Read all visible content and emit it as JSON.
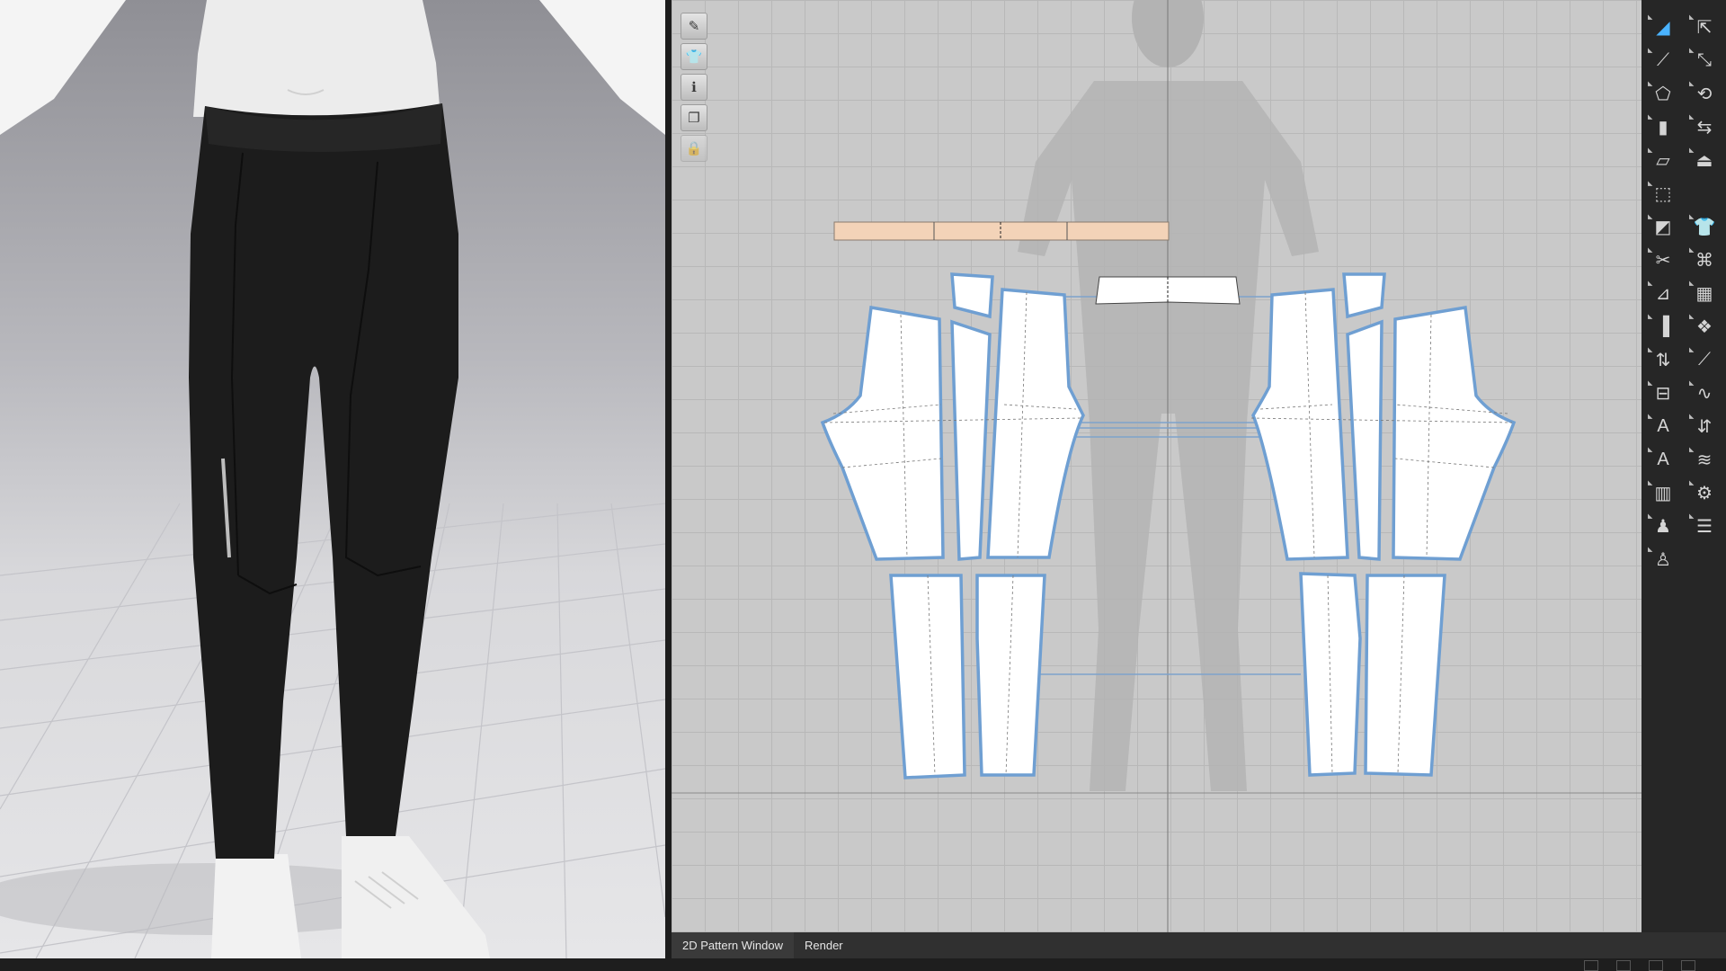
{
  "viewport_3d": {
    "garment": "leggings",
    "avatar": "male"
  },
  "pattern_window": {
    "mini_toolbar": [
      {
        "icon": "pen-tool-icon",
        "glyph": "✎",
        "enabled": true
      },
      {
        "icon": "shirt-icon",
        "glyph": "👕",
        "enabled": true
      },
      {
        "icon": "info-icon",
        "glyph": "ℹ",
        "enabled": true
      },
      {
        "icon": "copy-pages-icon",
        "glyph": "❐",
        "enabled": true
      },
      {
        "icon": "lock-shirt-icon",
        "glyph": "🔒",
        "enabled": false
      }
    ]
  },
  "right_toolbar": [
    {
      "icon": "select-mesh-icon",
      "glyph": "◢"
    },
    {
      "icon": "transform-icon",
      "glyph": "⇱"
    },
    {
      "icon": "edit-point-icon",
      "glyph": "⟋"
    },
    {
      "icon": "edit-curve-icon",
      "glyph": "⤡"
    },
    {
      "icon": "polygon-icon",
      "glyph": "⬠"
    },
    {
      "icon": "rotate-icon",
      "glyph": "⟲"
    },
    {
      "icon": "rectangle-icon",
      "glyph": "▮"
    },
    {
      "icon": "flip-icon",
      "glyph": "⇆"
    },
    {
      "icon": "internal-polygon-icon",
      "glyph": "▱"
    },
    {
      "icon": "iron-icon",
      "glyph": "⏏"
    },
    {
      "icon": "dotted-rect-icon",
      "glyph": "⬚"
    },
    {
      "icon": "blank-icon",
      "glyph": ""
    },
    {
      "icon": "dart-icon",
      "glyph": "◩"
    },
    {
      "icon": "garment-icon",
      "glyph": "👕"
    },
    {
      "icon": "cut-icon",
      "glyph": "✂"
    },
    {
      "icon": "tag-icon",
      "glyph": "⌘"
    },
    {
      "icon": "fold-icon",
      "glyph": "⊿"
    },
    {
      "icon": "pattern-grid-icon",
      "glyph": "▦"
    },
    {
      "icon": "segment-sewing-icon",
      "glyph": "▐"
    },
    {
      "icon": "mesh-icon",
      "glyph": "❖"
    },
    {
      "icon": "free-sewing-icon",
      "glyph": "⇅"
    },
    {
      "icon": "tack-icon",
      "glyph": "⟋"
    },
    {
      "icon": "measure-icon",
      "glyph": "⊟"
    },
    {
      "icon": "wave-icon",
      "glyph": "∿"
    },
    {
      "icon": "annotation-icon",
      "glyph": "A"
    },
    {
      "icon": "arrange-icon",
      "glyph": "⇵"
    },
    {
      "icon": "text-icon",
      "glyph": "A"
    },
    {
      "icon": "topstitch-icon",
      "glyph": "≋"
    },
    {
      "icon": "grade-icon",
      "glyph": "▥"
    },
    {
      "icon": "fabric-icon",
      "glyph": "⚙"
    },
    {
      "icon": "avatar-measure-icon",
      "glyph": "♟"
    },
    {
      "icon": "stack-icon",
      "glyph": "☰"
    },
    {
      "icon": "pin-avatar-icon",
      "glyph": "♙"
    },
    {
      "icon": "blank-icon-2",
      "glyph": ""
    }
  ],
  "tabs": [
    {
      "label": "2D Pattern Window",
      "active": true
    },
    {
      "label": "Render",
      "active": false
    }
  ],
  "colors": {
    "pattern_outline": "#6f9fd2",
    "waistband_fill": "#f3d3b8",
    "pattern_fill": "#ffffff",
    "grid_bg": "#c9c9c9",
    "leggings": "#1c1c1c"
  }
}
